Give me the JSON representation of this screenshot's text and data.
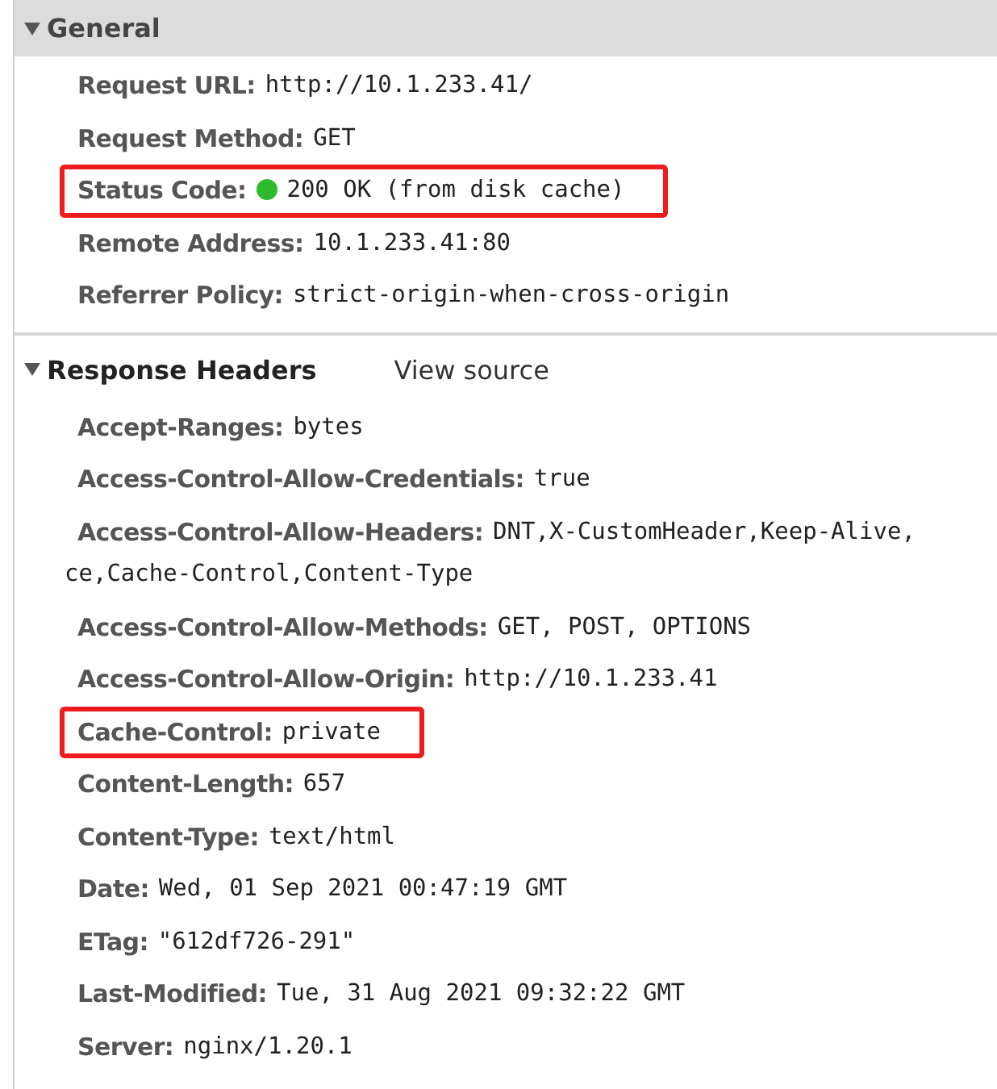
{
  "sections": [
    {
      "title": "General",
      "expanded": true,
      "shaded": true,
      "rows": [
        {
          "label": "Request URL:",
          "value": [
            "http://10.1.233.41/"
          ],
          "highlighted": false
        },
        {
          "label": "Request Method:",
          "value": [
            "GET"
          ],
          "highlighted": false
        },
        {
          "label": "Status Code:",
          "value": [
            "200 OK (from disk cache)"
          ],
          "highlighted": true,
          "status_dot": {
            "color": "#2dbb2d"
          }
        },
        {
          "label": "Remote Address:",
          "value": [
            "10.1.233.41:80"
          ],
          "highlighted": false
        },
        {
          "label": "Referrer Policy:",
          "value": [
            "strict-origin-when-cross-origin"
          ],
          "highlighted": false
        }
      ]
    },
    {
      "title": "Response Headers",
      "expanded": true,
      "shaded": false,
      "link": "View source",
      "rows": [
        {
          "label": "Accept-Ranges:",
          "value": [
            "bytes"
          ],
          "highlighted": false
        },
        {
          "label": "Access-Control-Allow-Credentials:",
          "value": [
            "true"
          ],
          "highlighted": false
        },
        {
          "label": "Access-Control-Allow-Headers:",
          "value": [
            "DNT,X-CustomHeader,Keep-Alive,",
            "ce,Cache-Control,Content-Type"
          ],
          "highlighted": false
        },
        {
          "label": "Access-Control-Allow-Methods:",
          "value": [
            "GET, POST, OPTIONS"
          ],
          "highlighted": false
        },
        {
          "label": "Access-Control-Allow-Origin:",
          "value": [
            "http://10.1.233.41"
          ],
          "highlighted": false
        },
        {
          "label": "Cache-Control:",
          "value": [
            "private"
          ],
          "highlighted": true
        },
        {
          "label": "Content-Length:",
          "value": [
            "657"
          ],
          "highlighted": false
        },
        {
          "label": "Content-Type:",
          "value": [
            "text/html"
          ],
          "highlighted": false
        },
        {
          "label": "Date:",
          "value": [
            "Wed, 01 Sep 2021 00:47:19 GMT"
          ],
          "highlighted": false
        },
        {
          "label": "ETag:",
          "value": [
            "\"612df726-291\""
          ],
          "highlighted": false
        },
        {
          "label": "Last-Modified:",
          "value": [
            "Tue, 31 Aug 2021 09:32:22 GMT"
          ],
          "highlighted": false
        },
        {
          "label": "Server:",
          "value": [
            "nginx/1.20.1"
          ],
          "highlighted": false
        }
      ]
    }
  ]
}
